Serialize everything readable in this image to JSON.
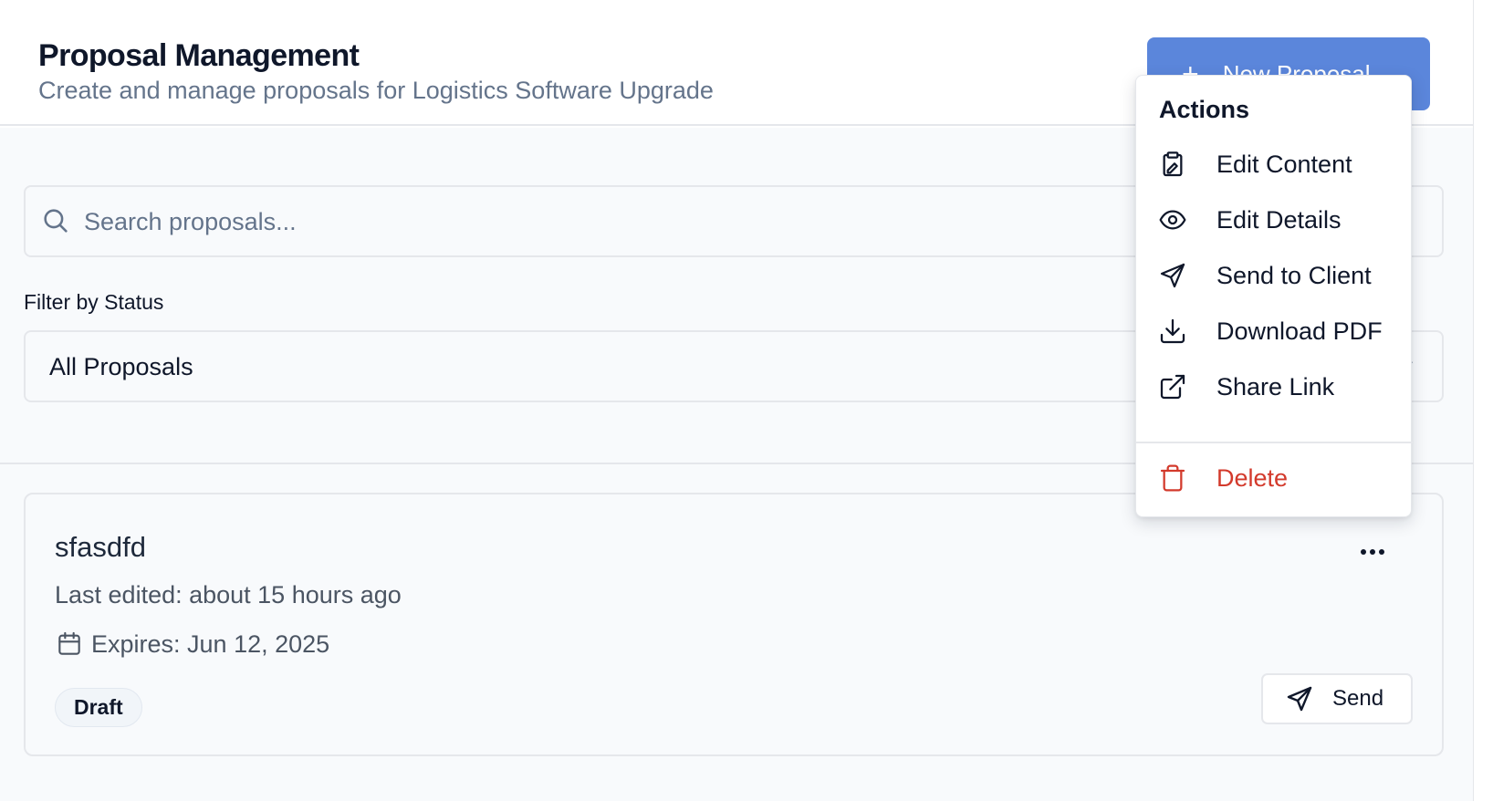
{
  "header": {
    "title": "Proposal Management",
    "subtitle": "Create and manage proposals for Logistics Software Upgrade",
    "new_button_label": "New Proposal"
  },
  "search": {
    "placeholder": "Search proposals...",
    "value": ""
  },
  "filter": {
    "label": "Filter by Status",
    "selected": "All Proposals"
  },
  "proposals": [
    {
      "title": "sfasdfd",
      "last_edited": "Last edited: about 15 hours ago",
      "expires": "Expires: Jun 12, 2025",
      "status": "Draft",
      "send_label": "Send"
    }
  ],
  "actions_menu": {
    "title": "Actions",
    "items": [
      {
        "label": "Edit Content",
        "icon": "clipboard-edit-icon"
      },
      {
        "label": "Edit Details",
        "icon": "eye-icon"
      },
      {
        "label": "Send to Client",
        "icon": "send-icon"
      },
      {
        "label": "Download PDF",
        "icon": "download-icon"
      },
      {
        "label": "Share Link",
        "icon": "external-link-icon"
      },
      {
        "label": "Delete",
        "icon": "trash-icon",
        "danger": true
      }
    ]
  },
  "colors": {
    "primary": "#5b86db",
    "danger": "#d33a2c",
    "muted_text": "#64748b",
    "border": "#e5e7eb",
    "background": "#f8fafc"
  }
}
